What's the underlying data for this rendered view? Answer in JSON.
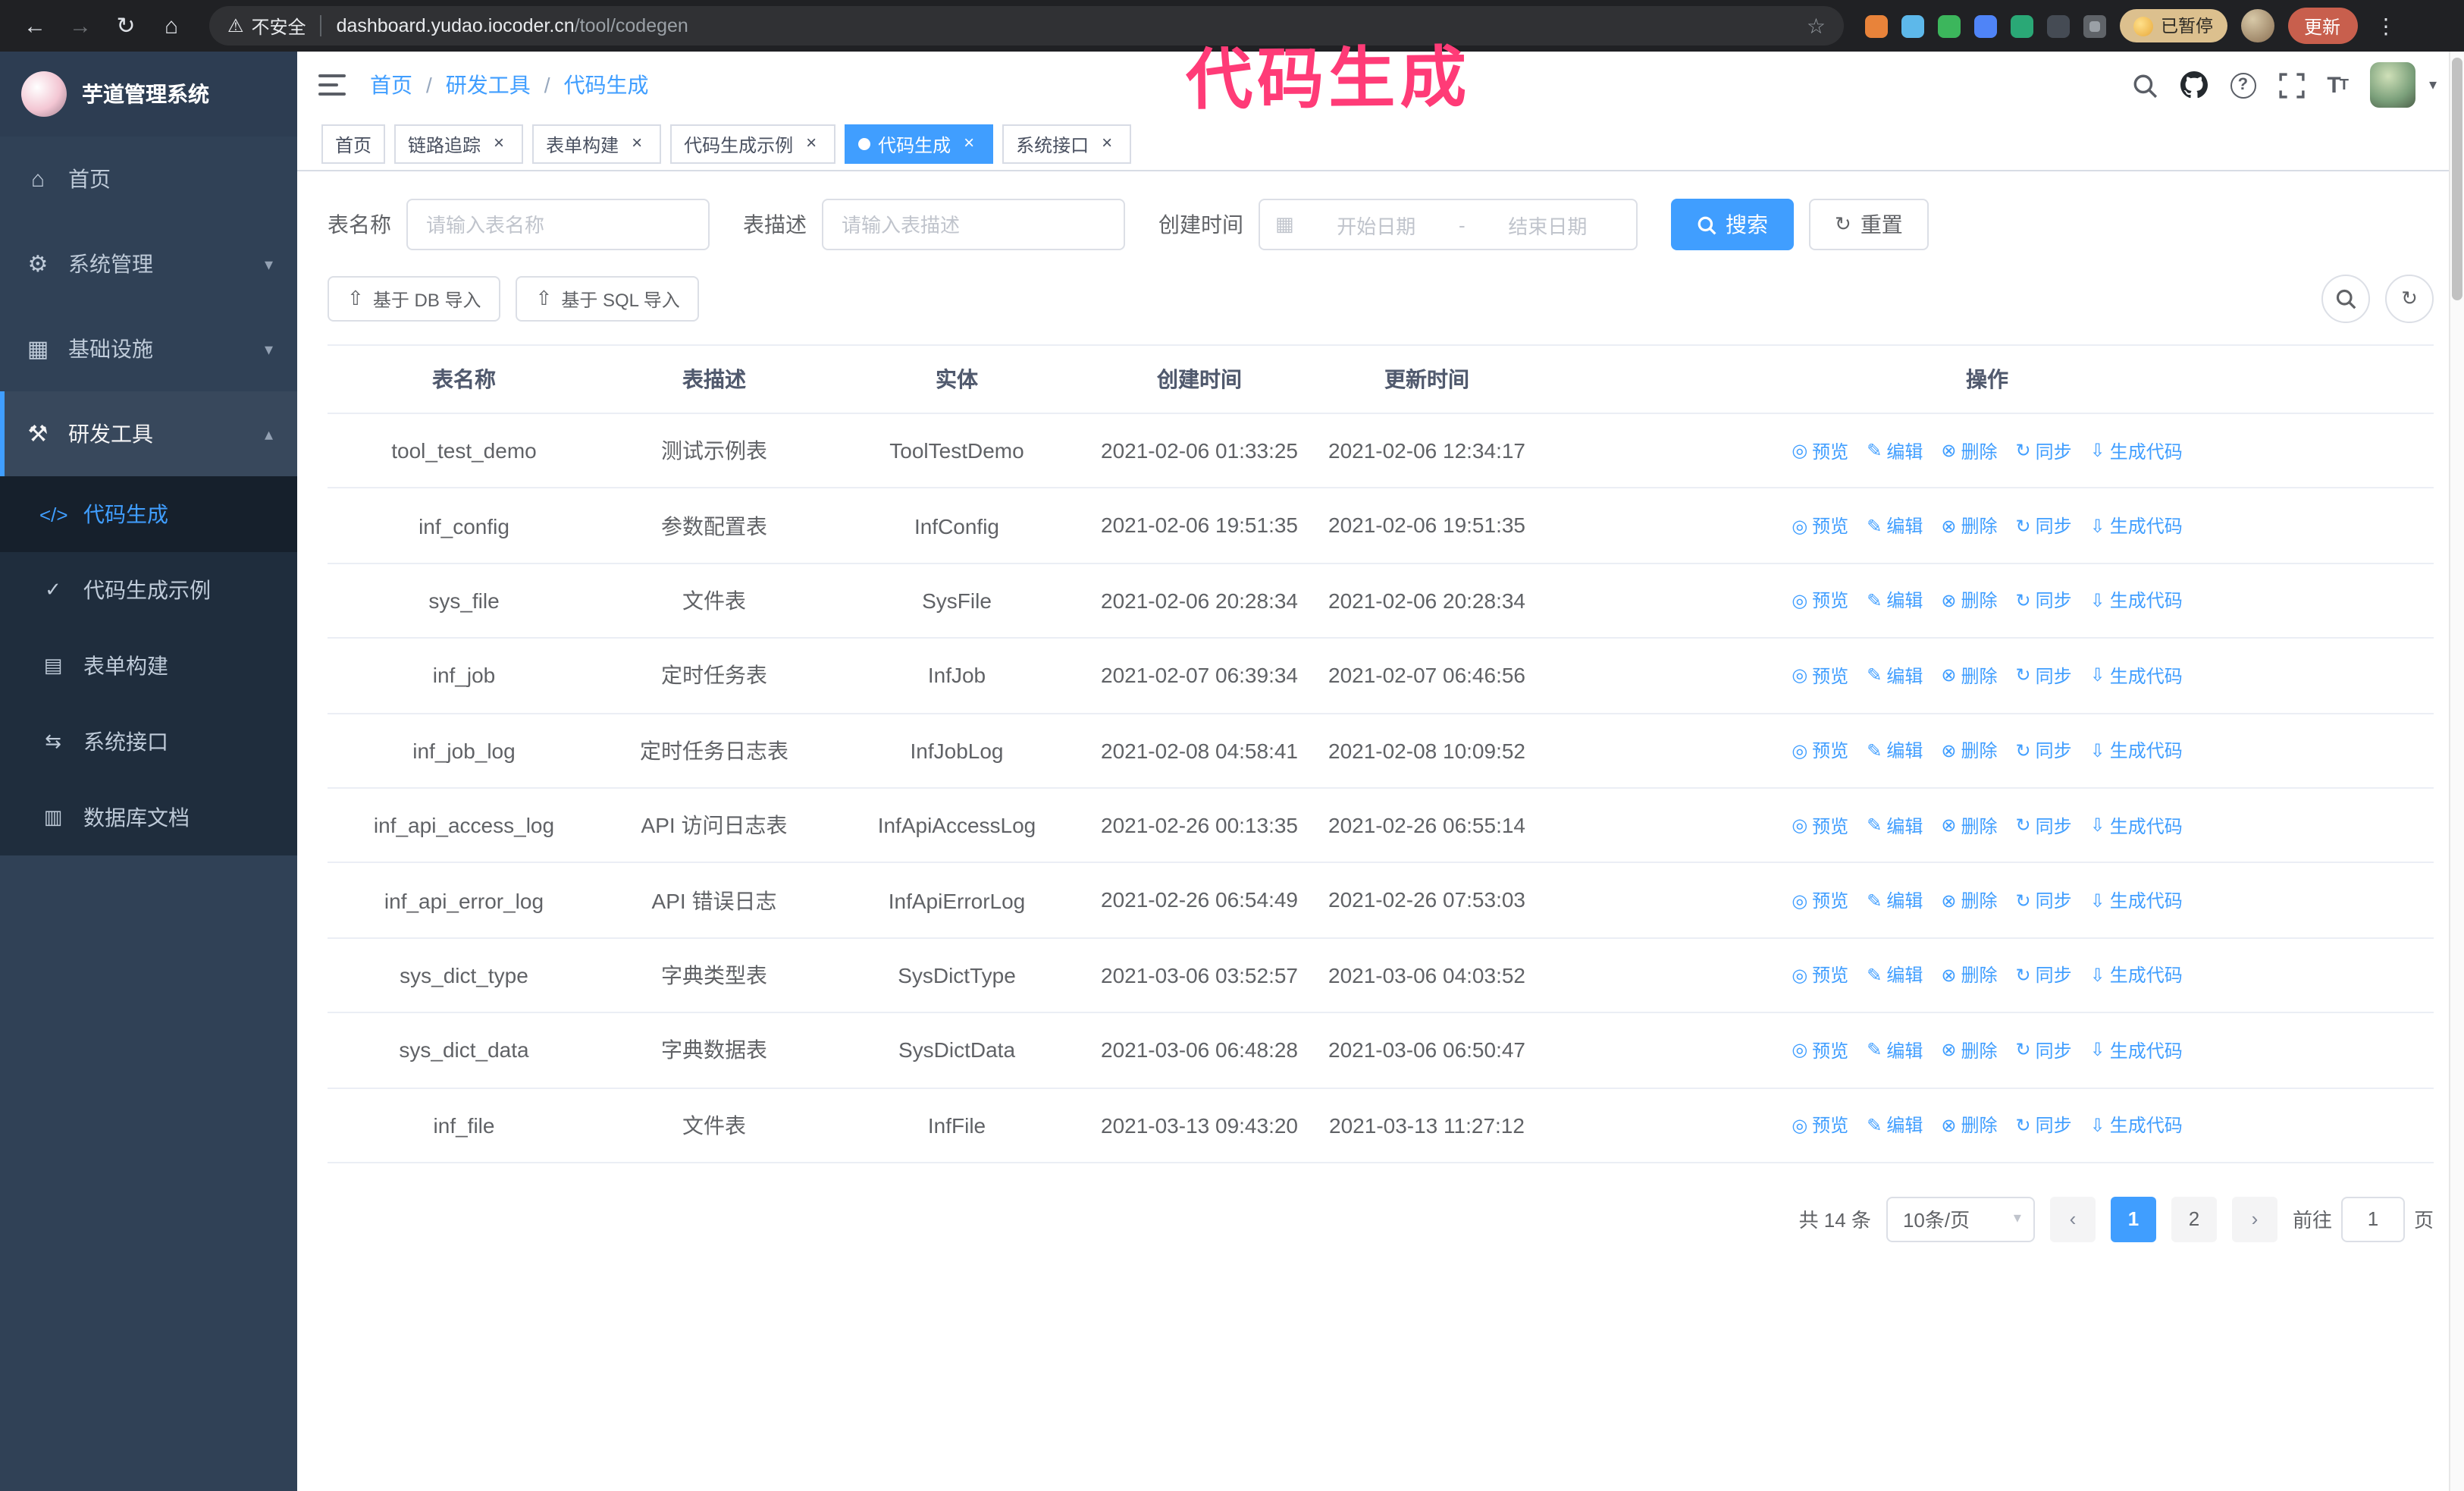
{
  "colors": {
    "primary": "#409eff",
    "chrome_bg": "#202124",
    "sidebar_bg": "#304156",
    "submenu_bg": "#1f2d3d",
    "annotation_pink": "#ff3b77",
    "update_button_bg": "#c85f4d"
  },
  "browser": {
    "security_label": "不安全",
    "url_host": "dashboard.yudao.iocoder.cn",
    "url_path": "/tool/codegen",
    "paused_badge": "已暂停",
    "update_button": "更新",
    "extension_colors": [
      "#e8833a",
      "#5db8ea",
      "#3cb65c",
      "#4f84f7",
      "#2aa876",
      "#454b54"
    ]
  },
  "annotation": {
    "text": "代码生成"
  },
  "sidebar": {
    "app_title": "芋道管理系统",
    "items": [
      {
        "label": "首页"
      },
      {
        "label": "系统管理"
      },
      {
        "label": "基础设施"
      },
      {
        "label": "研发工具"
      }
    ],
    "subitems": [
      {
        "label": "代码生成"
      },
      {
        "label": "代码生成示例"
      },
      {
        "label": "表单构建"
      },
      {
        "label": "系统接口"
      },
      {
        "label": "数据库文档"
      }
    ]
  },
  "breadcrumb": [
    "首页",
    "研发工具",
    "代码生成"
  ],
  "tags": [
    {
      "label": "首页"
    },
    {
      "label": "链路追踪"
    },
    {
      "label": "表单构建"
    },
    {
      "label": "代码生成示例"
    },
    {
      "label": "代码生成"
    },
    {
      "label": "系统接口"
    }
  ],
  "filters": {
    "name_label": "表名称",
    "name_placeholder": "请输入表名称",
    "desc_label": "表描述",
    "desc_placeholder": "请输入表描述",
    "time_label": "创建时间",
    "start_placeholder": "开始日期",
    "range_separator": "-",
    "end_placeholder": "结束日期",
    "search_button": "搜索",
    "reset_button": "重置"
  },
  "toolbar": {
    "import_db_button": "基于 DB 导入",
    "import_sql_button": "基于 SQL 导入"
  },
  "table": {
    "columns": [
      "表名称",
      "表描述",
      "实体",
      "创建时间",
      "更新时间",
      "操作"
    ],
    "actions": [
      "预览",
      "编辑",
      "删除",
      "同步",
      "生成代码"
    ],
    "rows": [
      {
        "name": "tool_test_demo",
        "desc": "测试示例表",
        "entity": "ToolTestDemo",
        "created": "2021-02-06 01:33:25",
        "updated": "2021-02-06 12:34:17"
      },
      {
        "name": "inf_config",
        "desc": "参数配置表",
        "entity": "InfConfig",
        "created": "2021-02-06 19:51:35",
        "updated": "2021-02-06 19:51:35"
      },
      {
        "name": "sys_file",
        "desc": "文件表",
        "entity": "SysFile",
        "created": "2021-02-06 20:28:34",
        "updated": "2021-02-06 20:28:34"
      },
      {
        "name": "inf_job",
        "desc": "定时任务表",
        "entity": "InfJob",
        "created": "2021-02-07 06:39:34",
        "updated": "2021-02-07 06:46:56"
      },
      {
        "name": "inf_job_log",
        "desc": "定时任务日志表",
        "entity": "InfJobLog",
        "created": "2021-02-08 04:58:41",
        "updated": "2021-02-08 10:09:52"
      },
      {
        "name": "inf_api_access_log",
        "desc": "API 访问日志表",
        "entity": "InfApiAccessLog",
        "created": "2021-02-26 00:13:35",
        "updated": "2021-02-26 06:55:14"
      },
      {
        "name": "inf_api_error_log",
        "desc": "API 错误日志",
        "entity": "InfApiErrorLog",
        "created": "2021-02-26 06:54:49",
        "updated": "2021-02-26 07:53:03"
      },
      {
        "name": "sys_dict_type",
        "desc": "字典类型表",
        "entity": "SysDictType",
        "created": "2021-03-06 03:52:57",
        "updated": "2021-03-06 04:03:52"
      },
      {
        "name": "sys_dict_data",
        "desc": "字典数据表",
        "entity": "SysDictData",
        "created": "2021-03-06 06:48:28",
        "updated": "2021-03-06 06:50:47"
      },
      {
        "name": "inf_file",
        "desc": "文件表",
        "entity": "InfFile",
        "created": "2021-03-13 09:43:20",
        "updated": "2021-03-13 11:27:12"
      }
    ]
  },
  "pagination": {
    "total": "共 14 条",
    "page_size": "10条/页",
    "page1": "1",
    "page2": "2",
    "goto_label": "前往",
    "goto_value": "1",
    "goto_suffix": "页"
  },
  "icons": {
    "back": "←",
    "forward": "→",
    "reload": "↻",
    "home_nav": "⌂",
    "warning": "⚠",
    "star": "☆",
    "kebab": "⋮",
    "close": "×",
    "breadcrumb_separator": "/",
    "chevron_down": "▾",
    "chevron_up": "▴",
    "caret_down": "▾",
    "prev": "‹",
    "next": "›",
    "home": "⌂",
    "system": "⚙",
    "infra": "▦",
    "devtools": "⚒",
    "codegen": "</>",
    "codegen_demo": "✓",
    "form_builder": "▤",
    "api": "⇆",
    "db_doc": "▥",
    "calendar": "▦",
    "refresh": "↻",
    "upload": "⇧",
    "preview": "◎",
    "edit": "✎",
    "delete": "⊗",
    "sync": "↻",
    "generate": "⇩"
  }
}
